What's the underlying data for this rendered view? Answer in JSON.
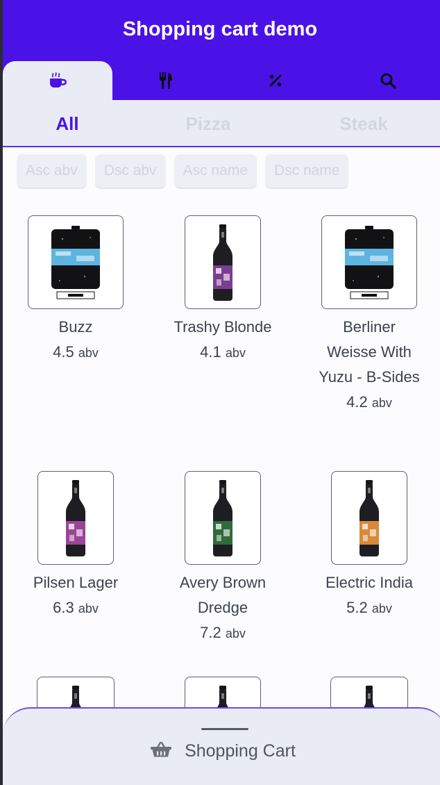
{
  "header": {
    "title": "Shopping cart demo"
  },
  "nav_tabs": [
    {
      "icon": "coffee-cup-icon"
    },
    {
      "icon": "utensils-icon"
    },
    {
      "icon": "percent-icon"
    },
    {
      "icon": "search-icon"
    }
  ],
  "sub_tabs": [
    {
      "label": "All"
    },
    {
      "label": "Pizza"
    },
    {
      "label": "Steak"
    }
  ],
  "sort_buttons": [
    {
      "label": "Asc abv"
    },
    {
      "label": "Dsc abv"
    },
    {
      "label": "Asc name"
    },
    {
      "label": "Dsc name"
    }
  ],
  "abv_unit": "abv",
  "products": [
    {
      "name": "Buzz",
      "abv": "4.5",
      "image": "keg-can-blue",
      "label_color": "#5eb4e0"
    },
    {
      "name": "Trashy Blonde",
      "abv": "4.1",
      "image": "bottle",
      "label_color": "#7a3e8e"
    },
    {
      "name": "Berliner Weisse With Yuzu - B-Sides",
      "abv": "4.2",
      "image": "keg-can-blue",
      "label_color": "#5eb4e0"
    },
    {
      "name": "Pilsen Lager",
      "abv": "6.3",
      "image": "bottle",
      "label_color": "#9b4596"
    },
    {
      "name": "Avery Brown Dredge",
      "abv": "7.2",
      "image": "bottle",
      "label_color": "#2f6b3a"
    },
    {
      "name": "Electric India",
      "abv": "5.2",
      "image": "bottle",
      "label_color": "#d88a3a"
    },
    {
      "name": "",
      "abv": "",
      "image": "bottle",
      "label_color": "#333333"
    },
    {
      "name": "",
      "abv": "",
      "image": "bottle",
      "label_color": "#333333"
    },
    {
      "name": "",
      "abv": "",
      "image": "bottle",
      "label_color": "#333333"
    }
  ],
  "cart": {
    "label": "Shopping Cart",
    "icon": "basket-icon"
  },
  "colors": {
    "brand": "#4a12e6",
    "panel": "#e9ecf4"
  }
}
